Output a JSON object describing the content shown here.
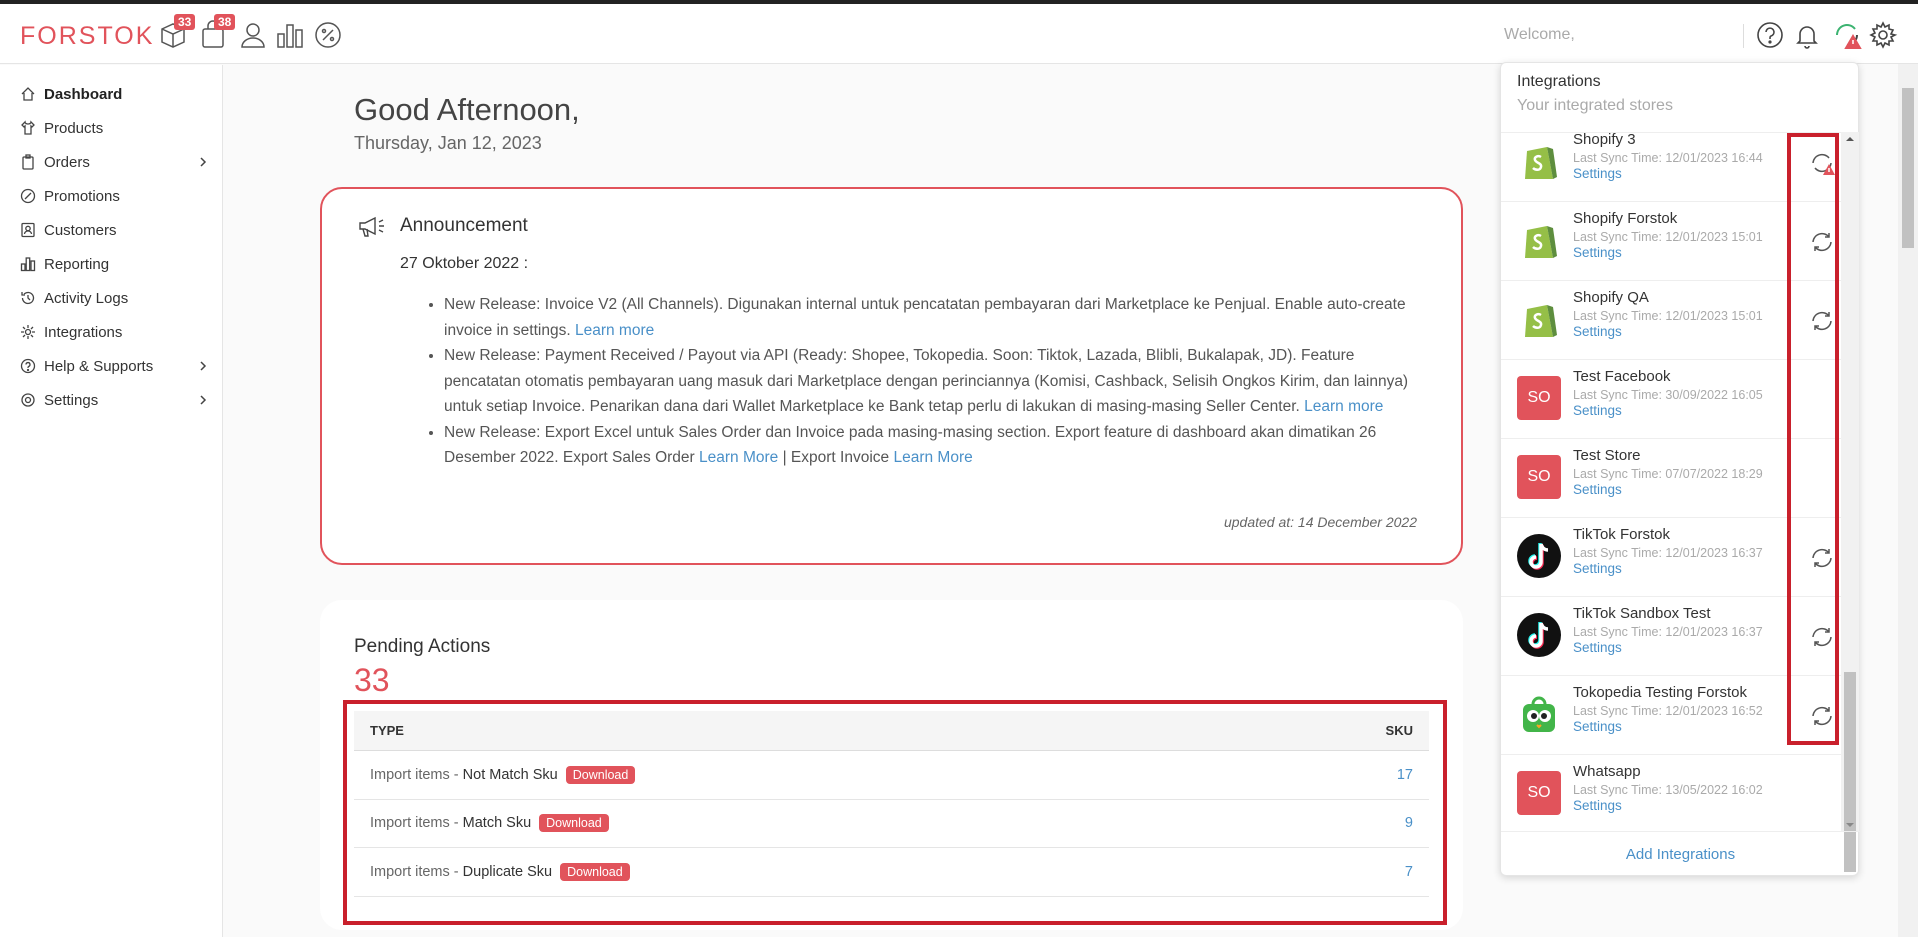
{
  "header": {
    "logo": "FORSTOK",
    "badges": {
      "inventory": "33",
      "orders": "38"
    },
    "welcome": "Welcome,"
  },
  "sidebar": {
    "items": [
      {
        "label": "Dashboard",
        "icon": "home-icon"
      },
      {
        "label": "Products",
        "icon": "shirt-icon"
      },
      {
        "label": "Orders",
        "icon": "clipboard-icon"
      },
      {
        "label": "Promotions",
        "icon": "discount-icon"
      },
      {
        "label": "Customers",
        "icon": "contact-icon"
      },
      {
        "label": "Reporting",
        "icon": "chart-icon"
      },
      {
        "label": "Activity Logs",
        "icon": "history-icon"
      },
      {
        "label": "Integrations",
        "icon": "gear-icon"
      },
      {
        "label": "Help & Supports",
        "icon": "question-icon"
      },
      {
        "label": "Settings",
        "icon": "settings-icon"
      }
    ]
  },
  "main": {
    "greeting": "Good Afternoon,",
    "date": "Thursday, Jan 12, 2023",
    "announcement": {
      "title": "Announcement",
      "date": "27 Oktober 2022 :",
      "items": [
        {
          "text": "New Release: Invoice V2 (All Channels). Digunakan internal untuk pencatatan pembayaran dari Marketplace ke Penjual. Enable auto-create invoice in settings.",
          "link": "Learn more"
        },
        {
          "text": "New Release: Payment Received / Payout via API (Ready: Shopee, Tokopedia. Soon: Tiktok, Lazada, Blibli, Bukalapak, JD). Feature pencatatan otomatis pembayaran uang masuk dari Marketplace dengan perinciannya (Komisi, Cashback, Selisih Ongkos Kirim, dan lainnya) untuk setiap Invoice. Penarikan dana dari Wallet Marketplace ke Bank tetap perlu di lakukan di masing-masing Seller Center.",
          "link": "Learn more"
        },
        {
          "text": "New Release: Export Excel untuk Sales Order dan Invoice pada masing-masing section. Export feature di dashboard akan dimatikan 26 Desember 2022. Export Sales Order",
          "link": "Learn More",
          "sep": "| Export Invoice",
          "link2": "Learn More"
        }
      ],
      "updated": "updated at: 14 December 2022"
    },
    "pending": {
      "title": "Pending Actions",
      "count": "33",
      "col_type": "TYPE",
      "col_sku": "SKU",
      "rows": [
        {
          "prefix": "Import items -",
          "name": "Not Match Sku",
          "btn": "Download",
          "sku": "17"
        },
        {
          "prefix": "Import items -",
          "name": "Match Sku",
          "btn": "Download",
          "sku": "9"
        },
        {
          "prefix": "Import items -",
          "name": "Duplicate Sku",
          "btn": "Download",
          "sku": "7"
        }
      ]
    }
  },
  "integrations": {
    "title": "Integrations",
    "subtitle": "Your integrated stores",
    "settings_label": "Settings",
    "add_label": "Add Integrations",
    "stores": [
      {
        "name": "Shopify 3",
        "sync": "Last Sync Time: 12/01/2023 16:44",
        "logo": "shopify",
        "status": "sync-error"
      },
      {
        "name": "Shopify Forstok",
        "sync": "Last Sync Time: 12/01/2023 15:01",
        "logo": "shopify",
        "status": "sync"
      },
      {
        "name": "Shopify QA",
        "sync": "Last Sync Time: 12/01/2023 15:01",
        "logo": "shopify",
        "status": "sync"
      },
      {
        "name": "Test Facebook",
        "sync": "Last Sync Time: 30/09/2022 16:05",
        "logo": "SO",
        "status": "none"
      },
      {
        "name": "Test Store",
        "sync": "Last Sync Time: 07/07/2022 18:29",
        "logo": "SO",
        "status": "none"
      },
      {
        "name": "TikTok Forstok",
        "sync": "Last Sync Time: 12/01/2023 16:37",
        "logo": "tiktok",
        "status": "sync"
      },
      {
        "name": "TikTok Sandbox Test",
        "sync": "Last Sync Time: 12/01/2023 16:37",
        "logo": "tiktok",
        "status": "sync"
      },
      {
        "name": "Tokopedia Testing Forstok",
        "sync": "Last Sync Time: 12/01/2023 16:52",
        "logo": "tokopedia",
        "status": "sync"
      },
      {
        "name": "Whatsapp",
        "sync": "Last Sync Time: 13/05/2022 16:02",
        "logo": "SO",
        "status": "none"
      }
    ]
  },
  "colors": {
    "brand": "#e1535b",
    "link": "#4a90c8",
    "highlight": "#c9202c"
  }
}
